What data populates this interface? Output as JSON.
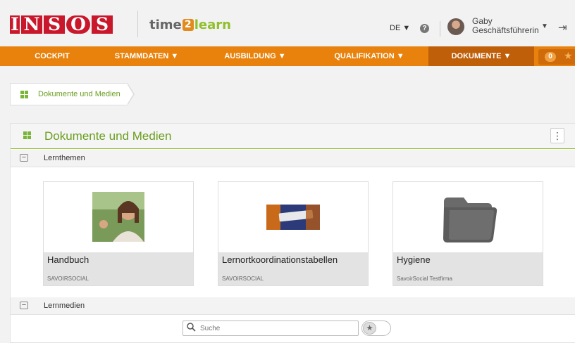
{
  "header": {
    "logo_letters": [
      "I",
      "N",
      "S",
      "O",
      "S"
    ],
    "app_logo": {
      "part1": "time",
      "part2": "2",
      "part3": "learn"
    },
    "language": "DE ▼",
    "help_glyph": "?",
    "user": {
      "name": "Gaby",
      "role": "Geschäftsführerin"
    },
    "user_caret": "▼",
    "logout_glyph": "⇥"
  },
  "nav": {
    "items": [
      {
        "label": "COCKPIT"
      },
      {
        "label": "STAMMDATEN ▼"
      },
      {
        "label": "AUSBILDUNG ▼"
      },
      {
        "label": "QUALIFIKATION ▼"
      },
      {
        "label": "DOKUMENTE ▼"
      }
    ],
    "badge_count": "0",
    "star_glyph": "★"
  },
  "breadcrumb": {
    "label": "Dokumente und Medien"
  },
  "panel": {
    "title": "Dokumente und Medien",
    "menu_glyph": "⋮",
    "groups": [
      {
        "toggle": "−",
        "label": "Lernthemen"
      },
      {
        "toggle": "−",
        "label": "Lernmedien"
      }
    ],
    "cards": [
      {
        "title": "Handbuch",
        "subtitle": "SAVOIRSOCIAL",
        "thumb": "photo-woman-icon"
      },
      {
        "title": "Lernortkoordinationstabellen",
        "subtitle": "SAVOIRSOCIAL",
        "thumb": "photo-keyboard-icon"
      },
      {
        "title": "Hygiene",
        "subtitle": "SavoirSocial Testfirma",
        "thumb": "folder-icon"
      }
    ]
  },
  "search": {
    "placeholder": "Suche",
    "icon": "search-icon",
    "fav_glyph": "★"
  },
  "colors": {
    "accent_orange": "#e8820c",
    "active_nav": "#bf5f0a",
    "green": "#6a9e1f",
    "brand_red": "#c9182c"
  }
}
